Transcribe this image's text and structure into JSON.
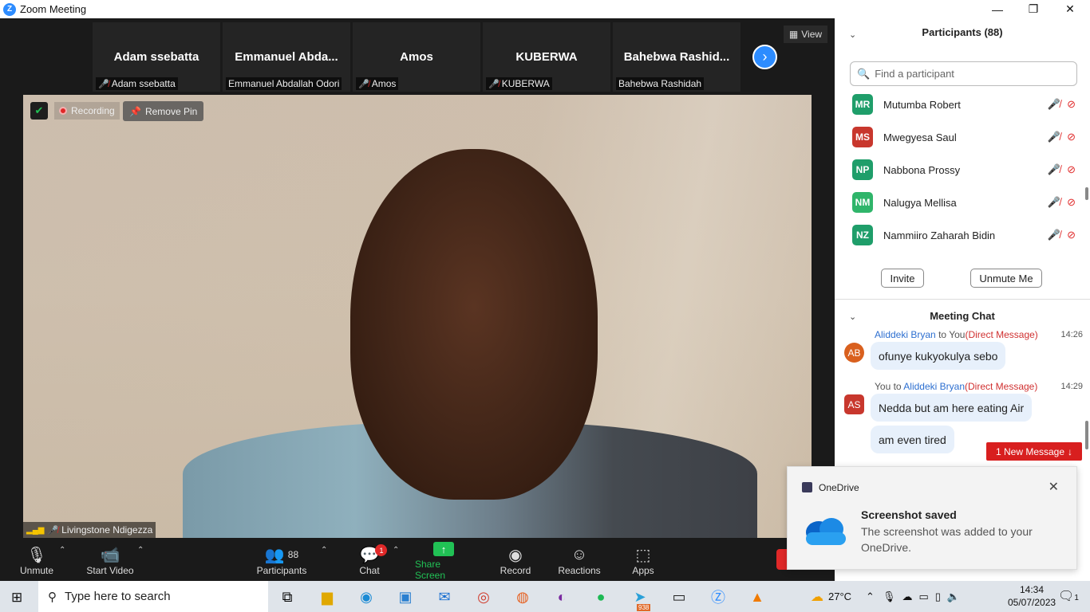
{
  "window": {
    "title": "Zoom Meeting"
  },
  "gallery": {
    "tiles": [
      {
        "display": "Adam ssebatta",
        "label": "Adam ssebatta",
        "muted": true
      },
      {
        "display": "Emmanuel  Abda...",
        "label": "Emmanuel Abdallah Odori",
        "muted": false
      },
      {
        "display": "Amos",
        "label": "Amos",
        "muted": true
      },
      {
        "display": "KUBERWA",
        "label": "KUBERWA",
        "muted": true
      },
      {
        "display": "Bahebwa  Rashid...",
        "label": "Bahebwa Rashidah",
        "muted": false
      }
    ],
    "view_label": "View"
  },
  "video": {
    "recording_label": "Recording",
    "remove_pin_label": "Remove Pin",
    "speaker_name": "Livingstone Ndigezza"
  },
  "toolbar": {
    "unmute": "Unmute",
    "start_video": "Start Video",
    "participants": "Participants",
    "participants_count": "88",
    "chat": "Chat",
    "chat_badge": "1",
    "share_screen": "Share Screen",
    "record": "Record",
    "reactions": "Reactions",
    "apps": "Apps"
  },
  "participants_panel": {
    "title": "Participants (88)",
    "search_placeholder": "Find a participant",
    "people": [
      {
        "initials": "MR",
        "name": "Mutumba Robert",
        "color": "#1f9e6a"
      },
      {
        "initials": "MS",
        "name": "Mwegyesa Saul",
        "color": "#c8372d"
      },
      {
        "initials": "NP",
        "name": "Nabbona Prossy",
        "color": "#1f9e6a"
      },
      {
        "initials": "NM",
        "name": "Nalugya Mellisa",
        "color": "#2fb56a"
      },
      {
        "initials": "NZ",
        "name": "Nammiiro Zaharah Bidin",
        "color": "#1f9e6a"
      }
    ],
    "invite": "Invite",
    "unmute_me": "Unmute Me"
  },
  "chat_panel": {
    "title": "Meeting Chat",
    "messages": [
      {
        "avatar": "AB",
        "avatar_color": "#d9601e",
        "from": "Aliddeki Bryan",
        "to": "You",
        "tag": "(Direct Message)",
        "time": "14:26",
        "bubbles": [
          "ofunye kukyokulya sebo"
        ]
      },
      {
        "avatar": "AS",
        "avatar_color": "#c8372d",
        "from": "You",
        "to": "Aliddeki Bryan",
        "tag": "(Direct Message)",
        "time": "14:29",
        "bubbles": [
          "Nedda but am here eating Air",
          "am even tired"
        ]
      }
    ],
    "to_word": "to",
    "new_message": "1 New Message"
  },
  "toast": {
    "app": "OneDrive",
    "heading": "Screenshot saved",
    "body": "The screenshot was added to your OneDrive."
  },
  "taskbar": {
    "search_placeholder": "Type here to search",
    "weather": "27°C",
    "time": "14:34",
    "date": "05/07/2023",
    "telegram_badge": "938",
    "notifications": "1"
  }
}
